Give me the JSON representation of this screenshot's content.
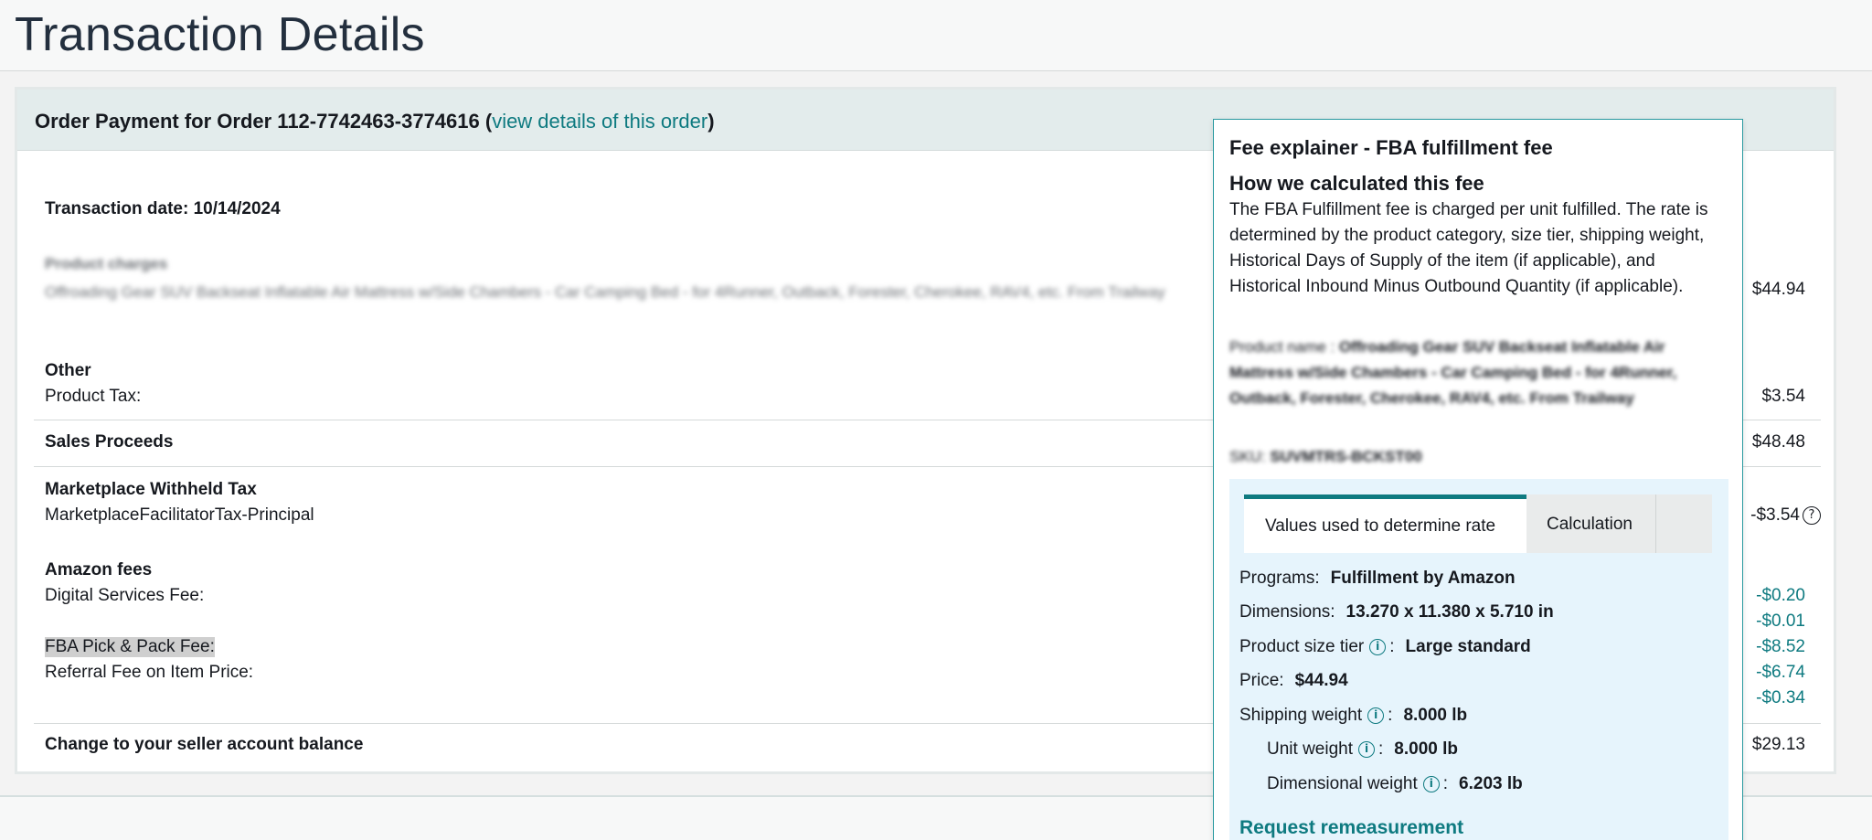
{
  "page": {
    "title": "Transaction Details"
  },
  "order": {
    "header_prefix": "Order Payment for Order 112-7742463-3774616 (",
    "view_link": "view details of this order",
    "header_suffix": ")",
    "transaction_date": "Transaction date: 10/14/2024"
  },
  "product_charges": {
    "label": "Product charges",
    "description": "Offroading Gear SUV Backseat Inflatable Air Mattress w/Side Chambers - Car Camping Bed - for 4Runner, Outback, Forester, Cherokee, RAV4, etc. From Trailway",
    "amount": "$44.94"
  },
  "other": {
    "label": "Other",
    "product_tax_label": "Product Tax:",
    "product_tax_amount": "$3.54"
  },
  "sales_proceeds": {
    "label": "Sales Proceeds",
    "amount": "$48.48"
  },
  "withheld_tax": {
    "label": "Marketplace Withheld Tax",
    "item_label": "MarketplaceFacilitatorTax-Principal",
    "amount": "-$3.54"
  },
  "amazon_fees": {
    "label": "Amazon fees",
    "digital_services_label": "Digital Services Fee:",
    "fba_label": "FBA Pick & Pack Fee:",
    "referral_label": "Referral Fee on Item Price:",
    "amounts": [
      "-$0.20",
      "-$0.01",
      "-$8.52",
      "-$6.74",
      "-$0.34"
    ]
  },
  "balance_change": {
    "label": "Change to your seller account balance",
    "amount": "$29.13"
  },
  "popover": {
    "title": "Fee explainer - FBA fulfillment fee",
    "subtitle": "How we calculated this fee",
    "description": "The FBA Fulfillment fee is charged per unit fulfilled. The rate is determined by the product category, size tier, shipping weight, Historical Days of Supply of the item (if applicable), and Historical Inbound Minus Outbound Quantity (if applicable).",
    "product_name_label": "Product name :",
    "product_name": "Offroading Gear SUV Backseat Inflatable Air Mattress w/Side Chambers - Car Camping Bed - for 4Runner, Outback, Forester, Cherokee, RAV4, etc. From Trailway",
    "sku_label": "SKU:",
    "sku": "SUVMTRS-BCKST00",
    "tabs": {
      "values": "Values used to determine rate",
      "calculation": "Calculation"
    },
    "fields": {
      "programs_label": "Programs:",
      "programs": "Fulfillment by Amazon",
      "dimensions_label": "Dimensions:",
      "dimensions": "13.270 x 11.380 x 5.710 in",
      "size_tier_label": "Product size tier",
      "size_tier": "Large standard",
      "price_label": "Price:",
      "price": "$44.94",
      "shipping_weight_label": "Shipping weight",
      "shipping_weight": "8.000 lb",
      "unit_weight_label": "Unit weight",
      "unit_weight": "8.000 lb",
      "dimensional_weight_label": "Dimensional weight",
      "dimensional_weight": "6.203 lb"
    },
    "remeasure_link": "Request remeasurement",
    "icons": {
      "info": "info-icon",
      "help": "question-circle-icon"
    }
  },
  "colors": {
    "accent": "#0e7a80",
    "header_bg": "#e3ecec",
    "panel_bg": "#e6f4fc"
  }
}
